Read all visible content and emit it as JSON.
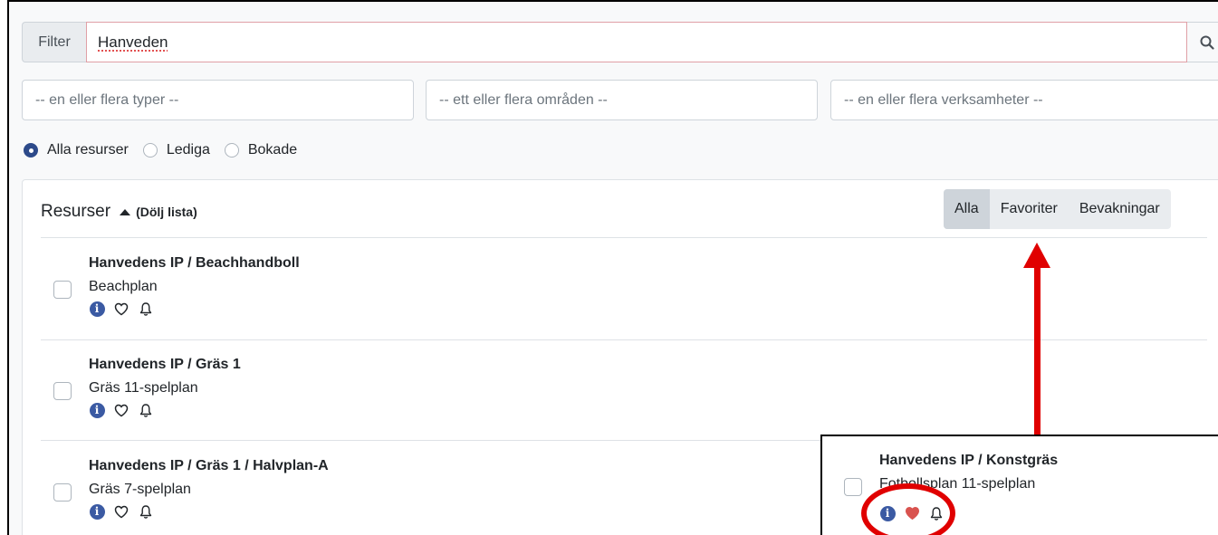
{
  "filter": {
    "label": "Filter",
    "value": "Hanveden"
  },
  "selects": [
    {
      "placeholder": "-- en eller flera typer --"
    },
    {
      "placeholder": "-- ett eller flera områden --"
    },
    {
      "placeholder": "-- en eller flera verksamheter --"
    }
  ],
  "radios": [
    {
      "label": "Alla resurser",
      "checked": true
    },
    {
      "label": "Lediga",
      "checked": false
    },
    {
      "label": "Bokade",
      "checked": false
    }
  ],
  "resources": {
    "title": "Resurser",
    "toggle_label": "(Dölj lista)",
    "tabs": [
      {
        "label": "Alla",
        "active": true
      },
      {
        "label": "Favoriter",
        "active": false
      },
      {
        "label": "Bevakningar",
        "active": false
      }
    ],
    "items": [
      {
        "title": "Hanvedens IP / Beachhandboll",
        "subtitle": "Beachplan",
        "favorite": false
      },
      {
        "title": "Hanvedens IP / Gräs 1",
        "subtitle": "Gräs 11-spelplan",
        "favorite": false
      },
      {
        "title": "Hanvedens IP / Gräs 1 / Halvplan-A",
        "subtitle": "Gräs 7-spelplan",
        "favorite": false
      }
    ]
  },
  "popup_item": {
    "title": "Hanvedens IP / Konstgräs",
    "subtitle": "Fotbollsplan 11-spelplan",
    "favorite": true
  },
  "colors": {
    "accent": "#2d4a8a",
    "info": "#3b5aa3",
    "favorite": "#d9534f",
    "annotation": "#e00000"
  },
  "icons": {
    "search": "search-icon",
    "info": "info-icon",
    "favorite": "heart-icon",
    "watch": "bell-icon"
  }
}
